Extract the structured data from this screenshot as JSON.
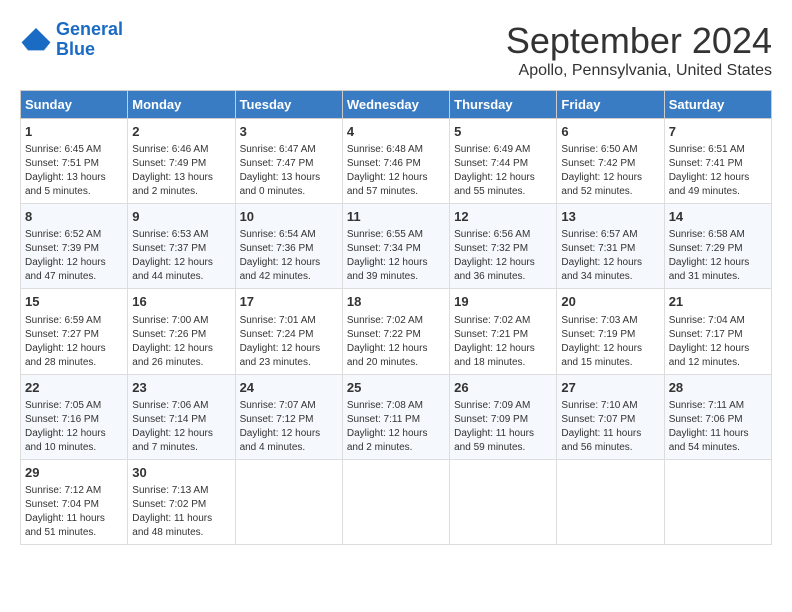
{
  "header": {
    "logo_line1": "General",
    "logo_line2": "Blue",
    "month": "September 2024",
    "location": "Apollo, Pennsylvania, United States"
  },
  "days_of_week": [
    "Sunday",
    "Monday",
    "Tuesday",
    "Wednesday",
    "Thursday",
    "Friday",
    "Saturday"
  ],
  "weeks": [
    [
      {
        "day": "1",
        "sunrise": "6:45 AM",
        "sunset": "7:51 PM",
        "daylight": "13 hours and 5 minutes."
      },
      {
        "day": "2",
        "sunrise": "6:46 AM",
        "sunset": "7:49 PM",
        "daylight": "13 hours and 2 minutes."
      },
      {
        "day": "3",
        "sunrise": "6:47 AM",
        "sunset": "7:47 PM",
        "daylight": "13 hours and 0 minutes."
      },
      {
        "day": "4",
        "sunrise": "6:48 AM",
        "sunset": "7:46 PM",
        "daylight": "12 hours and 57 minutes."
      },
      {
        "day": "5",
        "sunrise": "6:49 AM",
        "sunset": "7:44 PM",
        "daylight": "12 hours and 55 minutes."
      },
      {
        "day": "6",
        "sunrise": "6:50 AM",
        "sunset": "7:42 PM",
        "daylight": "12 hours and 52 minutes."
      },
      {
        "day": "7",
        "sunrise": "6:51 AM",
        "sunset": "7:41 PM",
        "daylight": "12 hours and 49 minutes."
      }
    ],
    [
      {
        "day": "8",
        "sunrise": "6:52 AM",
        "sunset": "7:39 PM",
        "daylight": "12 hours and 47 minutes."
      },
      {
        "day": "9",
        "sunrise": "6:53 AM",
        "sunset": "7:37 PM",
        "daylight": "12 hours and 44 minutes."
      },
      {
        "day": "10",
        "sunrise": "6:54 AM",
        "sunset": "7:36 PM",
        "daylight": "12 hours and 42 minutes."
      },
      {
        "day": "11",
        "sunrise": "6:55 AM",
        "sunset": "7:34 PM",
        "daylight": "12 hours and 39 minutes."
      },
      {
        "day": "12",
        "sunrise": "6:56 AM",
        "sunset": "7:32 PM",
        "daylight": "12 hours and 36 minutes."
      },
      {
        "day": "13",
        "sunrise": "6:57 AM",
        "sunset": "7:31 PM",
        "daylight": "12 hours and 34 minutes."
      },
      {
        "day": "14",
        "sunrise": "6:58 AM",
        "sunset": "7:29 PM",
        "daylight": "12 hours and 31 minutes."
      }
    ],
    [
      {
        "day": "15",
        "sunrise": "6:59 AM",
        "sunset": "7:27 PM",
        "daylight": "12 hours and 28 minutes."
      },
      {
        "day": "16",
        "sunrise": "7:00 AM",
        "sunset": "7:26 PM",
        "daylight": "12 hours and 26 minutes."
      },
      {
        "day": "17",
        "sunrise": "7:01 AM",
        "sunset": "7:24 PM",
        "daylight": "12 hours and 23 minutes."
      },
      {
        "day": "18",
        "sunrise": "7:02 AM",
        "sunset": "7:22 PM",
        "daylight": "12 hours and 20 minutes."
      },
      {
        "day": "19",
        "sunrise": "7:02 AM",
        "sunset": "7:21 PM",
        "daylight": "12 hours and 18 minutes."
      },
      {
        "day": "20",
        "sunrise": "7:03 AM",
        "sunset": "7:19 PM",
        "daylight": "12 hours and 15 minutes."
      },
      {
        "day": "21",
        "sunrise": "7:04 AM",
        "sunset": "7:17 PM",
        "daylight": "12 hours and 12 minutes."
      }
    ],
    [
      {
        "day": "22",
        "sunrise": "7:05 AM",
        "sunset": "7:16 PM",
        "daylight": "12 hours and 10 minutes."
      },
      {
        "day": "23",
        "sunrise": "7:06 AM",
        "sunset": "7:14 PM",
        "daylight": "12 hours and 7 minutes."
      },
      {
        "day": "24",
        "sunrise": "7:07 AM",
        "sunset": "7:12 PM",
        "daylight": "12 hours and 4 minutes."
      },
      {
        "day": "25",
        "sunrise": "7:08 AM",
        "sunset": "7:11 PM",
        "daylight": "12 hours and 2 minutes."
      },
      {
        "day": "26",
        "sunrise": "7:09 AM",
        "sunset": "7:09 PM",
        "daylight": "11 hours and 59 minutes."
      },
      {
        "day": "27",
        "sunrise": "7:10 AM",
        "sunset": "7:07 PM",
        "daylight": "11 hours and 56 minutes."
      },
      {
        "day": "28",
        "sunrise": "7:11 AM",
        "sunset": "7:06 PM",
        "daylight": "11 hours and 54 minutes."
      }
    ],
    [
      {
        "day": "29",
        "sunrise": "7:12 AM",
        "sunset": "7:04 PM",
        "daylight": "11 hours and 51 minutes."
      },
      {
        "day": "30",
        "sunrise": "7:13 AM",
        "sunset": "7:02 PM",
        "daylight": "11 hours and 48 minutes."
      },
      null,
      null,
      null,
      null,
      null
    ]
  ]
}
